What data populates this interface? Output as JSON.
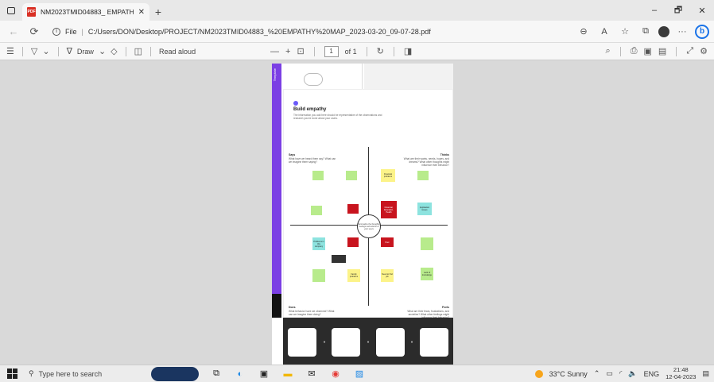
{
  "tab": {
    "title": "NM2023TMID04883_ EMPATHY",
    "close": "✕",
    "new_tab": "+"
  },
  "window_controls": {
    "minimize": "–",
    "restore": "🗗",
    "close": "✕"
  },
  "address": {
    "label": "File",
    "url": "C:/Users/DON/Desktop/PROJECT/NM2023TMID04883_%20EMPATHY%20MAP_2023-03-20_09-07-28.pdf"
  },
  "toolbar": {
    "draw": "Draw",
    "read_aloud": "Read aloud",
    "page_current": "1",
    "page_total": "of 1",
    "zoom_out": "—",
    "zoom_in": "+"
  },
  "pdf": {
    "side_label": "Template",
    "title": "Build empathy",
    "description": "The information you add here should be representative of the observations and research you've done about your users.",
    "quadrants": {
      "says_title": "Says",
      "says_text": "What have we heard them say? What can we imagine them saying?",
      "thinks_title": "Thinks",
      "thinks_text": "What are their wants, needs, hopes, and dreams? What other thoughts might influence their behavior?",
      "does_title": "Does",
      "does_text": "What behavior have we observed? What can we imagine them doing?",
      "feels_title": "Feels",
      "feels_text": "What are their fears, frustrations, and anxieties? What other feelings might influence their behavior?"
    },
    "center_text": "Summarize the thoughts, feelings and actions of your users",
    "notes": {
      "financial": "Financial problems",
      "red_top": "Financial, Education, Health",
      "application": "Application issues",
      "red_bottom": "Poor",
      "cyan_bl": "Problems in this company",
      "yellow_bl": "Family problems",
      "yellow_br": "Need to find job",
      "cyan_br": "Lack of knowledge"
    }
  },
  "taskbar": {
    "search_placeholder": "Type here to search",
    "weather": "33°C  Sunny",
    "lang": "ENG",
    "time": "21:48",
    "date": "12-04-2023"
  }
}
